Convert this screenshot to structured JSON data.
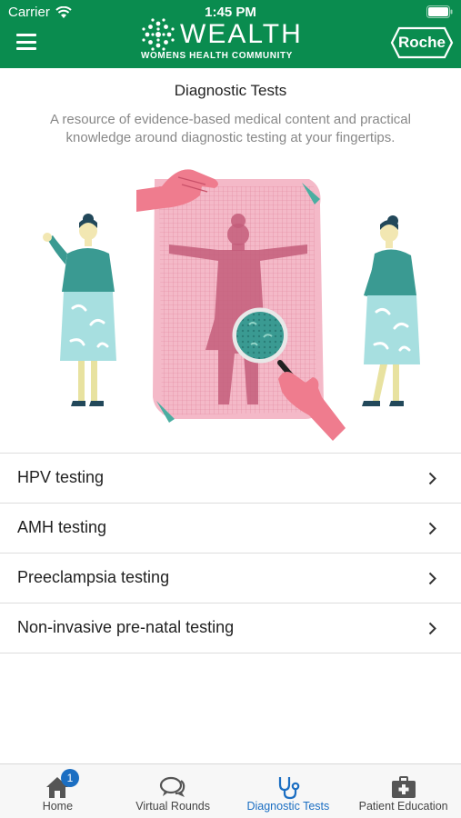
{
  "status_bar": {
    "carrier": "Carrier",
    "time": "1:45 PM"
  },
  "header": {
    "logo_word": "WEALTH",
    "logo_tagline": "WOMENS HEALTH COMMUNITY",
    "partner_label": "Roche",
    "brand_color": "#0a8c4f"
  },
  "main": {
    "title": "Diagnostic Tests",
    "subtitle": "A resource of evidence-based medical content and practical knowledge around diagnostic testing at your fingertips."
  },
  "tests": [
    {
      "label": "HPV testing"
    },
    {
      "label": "AMH testing"
    },
    {
      "label": "Preeclampsia testing"
    },
    {
      "label": "Non-invasive pre-natal testing"
    }
  ],
  "tabbar": {
    "active_color": "#1b6ec2",
    "tabs": [
      {
        "label": "Home",
        "icon": "home-icon",
        "badge": "1"
      },
      {
        "label": "Virtual Rounds",
        "icon": "chat-bubbles-icon"
      },
      {
        "label": "Diagnostic Tests",
        "icon": "stethoscope-icon",
        "active": true
      },
      {
        "label": "Patient Education",
        "icon": "medical-kit-icon"
      }
    ]
  }
}
